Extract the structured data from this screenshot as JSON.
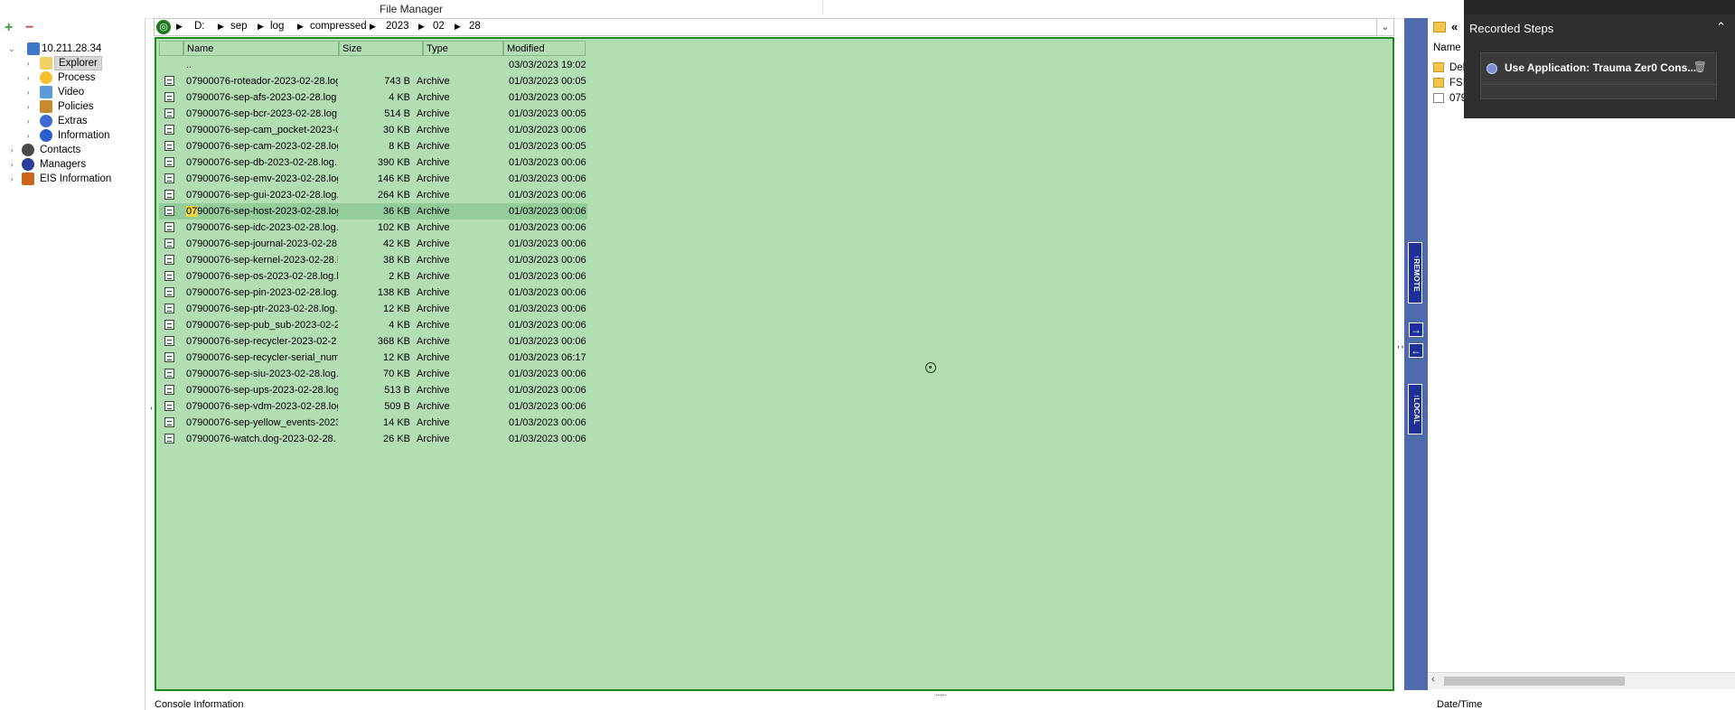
{
  "window": {
    "title": "File Manager"
  },
  "tree": {
    "add_label": "+",
    "remove_label": "−",
    "host": "10.211.28.34",
    "children": [
      "Explorer",
      "Process",
      "Video",
      "Policies",
      "Extras",
      "Information"
    ],
    "roots": [
      "Contacts",
      "Managers",
      "EIS Information"
    ]
  },
  "path": {
    "segments": [
      "D:",
      "sep",
      "log",
      "compressed",
      "2023",
      "02",
      "28"
    ]
  },
  "list": {
    "columns": {
      "name": "Name",
      "size": "Size",
      "type": "Type",
      "modified": "Modified"
    },
    "parent": {
      "name": "..",
      "modified": "03/03/2023 19:02"
    },
    "rows": [
      {
        "name": "07900076-roteador-2023-02-28.log",
        "size": "743 B",
        "type": "Archive",
        "modified": "01/03/2023 00:05"
      },
      {
        "name": "07900076-sep-afs-2023-02-28.log",
        "size": "4 KB",
        "type": "Archive",
        "modified": "01/03/2023 00:05"
      },
      {
        "name": "07900076-sep-bcr-2023-02-28.log",
        "size": "514 B",
        "type": "Archive",
        "modified": "01/03/2023 00:05"
      },
      {
        "name": "07900076-sep-cam_pocket-2023-0",
        "size": "30 KB",
        "type": "Archive",
        "modified": "01/03/2023 00:06"
      },
      {
        "name": "07900076-sep-cam-2023-02-28.log",
        "size": "8 KB",
        "type": "Archive",
        "modified": "01/03/2023 00:05"
      },
      {
        "name": "07900076-sep-db-2023-02-28.log.",
        "size": "390 KB",
        "type": "Archive",
        "modified": "01/03/2023 00:06"
      },
      {
        "name": "07900076-sep-emv-2023-02-28.log",
        "size": "146 KB",
        "type": "Archive",
        "modified": "01/03/2023 00:06"
      },
      {
        "name": "07900076-sep-gui-2023-02-28.log.",
        "size": "264 KB",
        "type": "Archive",
        "modified": "01/03/2023 00:06"
      },
      {
        "name": "07900076-sep-host-2023-02-28.log",
        "highlight": "07",
        "rest": "900076-sep-host-2023-02-28.log",
        "size": "36 KB",
        "type": "Archive",
        "modified": "01/03/2023 00:06",
        "selected": true
      },
      {
        "name": "07900076-sep-idc-2023-02-28.log.",
        "size": "102 KB",
        "type": "Archive",
        "modified": "01/03/2023 00:06"
      },
      {
        "name": "07900076-sep-journal-2023-02-28",
        "size": "42 KB",
        "type": "Archive",
        "modified": "01/03/2023 00:06"
      },
      {
        "name": "07900076-sep-kernel-2023-02-28.l",
        "size": "38 KB",
        "type": "Archive",
        "modified": "01/03/2023 00:06"
      },
      {
        "name": "07900076-sep-os-2023-02-28.log.l",
        "size": "2 KB",
        "type": "Archive",
        "modified": "01/03/2023 00:06"
      },
      {
        "name": "07900076-sep-pin-2023-02-28.log.",
        "size": "138 KB",
        "type": "Archive",
        "modified": "01/03/2023 00:06"
      },
      {
        "name": "07900076-sep-ptr-2023-02-28.log.",
        "size": "12 KB",
        "type": "Archive",
        "modified": "01/03/2023 00:06"
      },
      {
        "name": "07900076-sep-pub_sub-2023-02-2",
        "size": "4 KB",
        "type": "Archive",
        "modified": "01/03/2023 00:06"
      },
      {
        "name": "07900076-sep-recycler-2023-02-2",
        "size": "368 KB",
        "type": "Archive",
        "modified": "01/03/2023 00:06"
      },
      {
        "name": "07900076-sep-recycler-serial_numl",
        "size": "12 KB",
        "type": "Archive",
        "modified": "01/03/2023 06:17"
      },
      {
        "name": "07900076-sep-siu-2023-02-28.log.",
        "size": "70 KB",
        "type": "Archive",
        "modified": "01/03/2023 00:06"
      },
      {
        "name": "07900076-sep-ups-2023-02-28.log",
        "size": "513 B",
        "type": "Archive",
        "modified": "01/03/2023 00:06"
      },
      {
        "name": "07900076-sep-vdm-2023-02-28.log",
        "size": "509 B",
        "type": "Archive",
        "modified": "01/03/2023 00:06"
      },
      {
        "name": "07900076-sep-yellow_events-2023",
        "size": "14 KB",
        "type": "Archive",
        "modified": "01/03/2023 00:06"
      },
      {
        "name": "07900076-watch.dog-2023-02-28.",
        "size": "26 KB",
        "type": "Archive",
        "modified": "01/03/2023 00:06"
      }
    ]
  },
  "transfer": {
    "remote_label": "REMOTE",
    "local_label": "LOCAL",
    "push_right": "→",
    "push_left": "←"
  },
  "local": {
    "back_label": "«",
    "name_header": "Name",
    "items": [
      {
        "name": "Deb",
        "kind": "folder"
      },
      {
        "name": "FSI",
        "kind": "folder"
      },
      {
        "name": "079",
        "kind": "file"
      }
    ]
  },
  "recorded_steps": {
    "title": "Recorded Steps",
    "steps": [
      "Use Application: Trauma Zer0 Cons..."
    ]
  },
  "status": {
    "left": "Console Information",
    "right": "Date/Time"
  },
  "colors": {
    "list_bg": "#b3ddb3",
    "list_border": "#1e8a1e",
    "strip": "#4e6aa9",
    "overlay": "#2f2f2f"
  }
}
